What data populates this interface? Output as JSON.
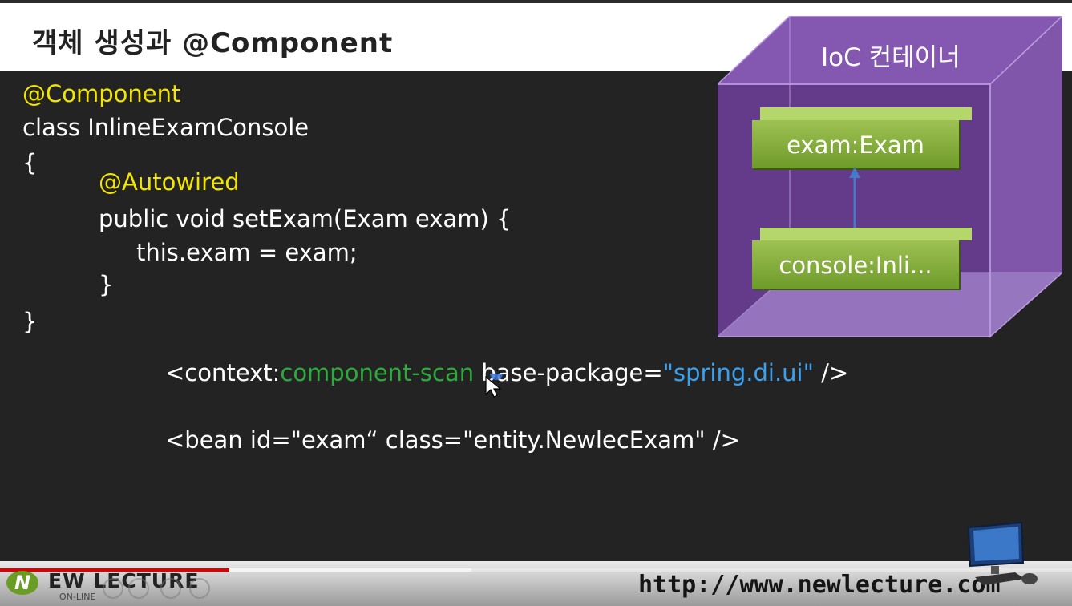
{
  "slide": {
    "title": "객체 생성과 @Component"
  },
  "code": {
    "line1": "@Component",
    "line2": "class InlineExamConsole",
    "line3": "{",
    "line4": "@Autowired",
    "line5": "public void setExam(Exam exam) {",
    "line6": "this.exam = exam;",
    "line7": "}",
    "line8": "}"
  },
  "xml": {
    "scan_prefix": "<context:",
    "scan_tag": "component-scan",
    "scan_attr": " base-package=",
    "scan_value": "\"spring.di.ui\"",
    "scan_suffix": " />",
    "bean_line": "<bean id=\"exam“ class=\"entity.NewlecExam\" />"
  },
  "ioc": {
    "title": "IoC 컨테이너",
    "bean_top": "exam:Exam",
    "bean_bottom": "console:Inli..."
  },
  "footer": {
    "brand_logo": "N",
    "brand": "EW LECTURE",
    "brand_sub": "ON-LINE",
    "url": "http://www.newlecture.com",
    "progress_percent": 21
  },
  "colors": {
    "annotation": "#f2e600",
    "xml_tag": "#2eaa3c",
    "xml_value": "#3aa0f0",
    "cube": "#7a4aa8",
    "bean": "#8db43d",
    "progress": "#e00000"
  },
  "icons": [
    "cursor-icon",
    "computer-icon",
    "logo-icon"
  ]
}
